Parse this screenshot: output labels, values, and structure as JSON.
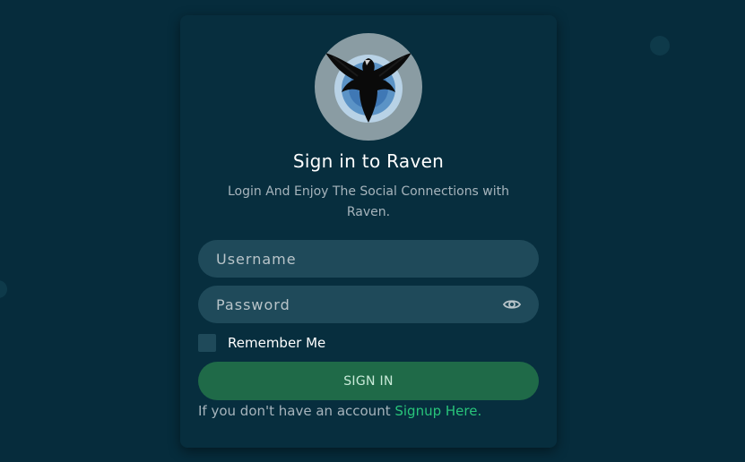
{
  "app": {
    "title": "Sign in to Raven",
    "subtitle": "Login And Enjoy The Social Connections with Raven."
  },
  "logo": {
    "icon": "raven-logo-icon"
  },
  "form": {
    "username_placeholder": "Username",
    "username_value": "",
    "password_placeholder": "Password",
    "password_value": "",
    "show_password_icon": "eye-icon",
    "remember_label": "Remember Me",
    "remember_checked": false,
    "submit_label": "SIGN IN"
  },
  "footer": {
    "prompt": "If you don't have an account",
    "link_label": "Signup Here."
  },
  "colors": {
    "background": "#062c3c",
    "card": "#072e3e",
    "field": "#1f4a5a",
    "button": "#1f6a48",
    "link": "#28c47a"
  }
}
